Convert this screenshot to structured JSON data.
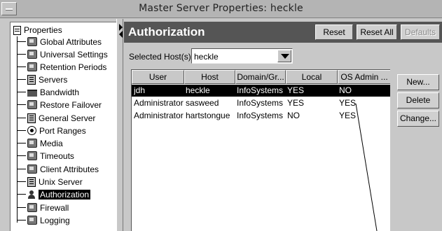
{
  "window": {
    "title": "Master Server Properties: heckle"
  },
  "tree": {
    "root": {
      "label": "Properties",
      "icon": "document-icon"
    },
    "items": [
      {
        "label": "Global Attributes",
        "icon": "globe-icon"
      },
      {
        "label": "Universal Settings",
        "icon": "settings-icon"
      },
      {
        "label": "Retention Periods",
        "icon": "retention-icon"
      },
      {
        "label": "Servers",
        "icon": "server-icon"
      },
      {
        "label": "Bandwidth",
        "icon": "bandwidth-icon"
      },
      {
        "label": "Restore Failover",
        "icon": "restore-icon"
      },
      {
        "label": "General Server",
        "icon": "server-icon"
      },
      {
        "label": "Port Ranges",
        "icon": "radio-icon"
      },
      {
        "label": "Media",
        "icon": "media-icon"
      },
      {
        "label": "Timeouts",
        "icon": "clock-icon"
      },
      {
        "label": "Client Attributes",
        "icon": "client-icon"
      },
      {
        "label": "Unix Server",
        "icon": "server-icon"
      },
      {
        "label": "Authorization",
        "icon": "person-icon",
        "selected": true
      },
      {
        "label": "Firewall",
        "icon": "firewall-icon"
      },
      {
        "label": "Logging",
        "icon": "logging-icon"
      }
    ]
  },
  "panel": {
    "title": "Authorization",
    "buttons": {
      "reset": "Reset",
      "reset_all": "Reset All",
      "defaults": "Defaults"
    },
    "selected_hosts_label": "Selected Host(s)",
    "selected_host": "heckle"
  },
  "table": {
    "columns": [
      "User",
      "Host",
      "Domain/Gr...",
      "Local",
      "OS Admin ..."
    ],
    "rows": [
      [
        "jdh",
        "heckle",
        "InfoSystems",
        "YES",
        "NO"
      ],
      [
        "Administrator",
        "sasweed",
        "InfoSystems",
        "YES",
        "YES"
      ],
      [
        "Administrator",
        "hartstongue",
        "InfoSystems",
        "NO",
        "YES"
      ]
    ],
    "selected_row": 0
  },
  "actions": {
    "new": "New...",
    "delete": "Delete",
    "change": "Change..."
  }
}
